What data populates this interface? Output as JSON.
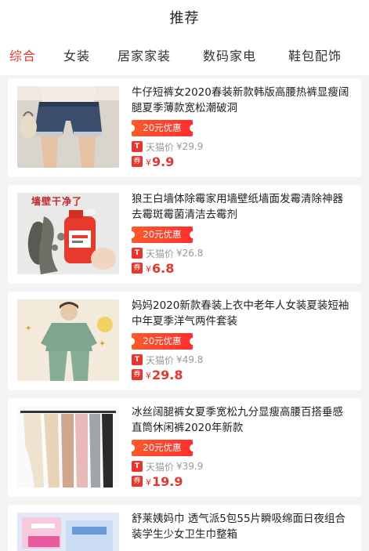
{
  "header": {
    "title": "推荐"
  },
  "tabs": [
    {
      "label": "综合",
      "active": true
    },
    {
      "label": "女装",
      "active": false
    },
    {
      "label": "居家家装",
      "active": false
    },
    {
      "label": "数码家电",
      "active": false
    },
    {
      "label": "鞋包配饰",
      "active": false
    }
  ],
  "products": [
    {
      "title": "牛仔短裤女2020春装新款韩版高腰热裤显瘦阔腿夏季薄款宽松潮破洞",
      "coupon": "20元优惠",
      "tmall_label": "天猫价",
      "tmall_price": "¥29.9",
      "currency": "¥",
      "final_price": "9.9",
      "image": "denim-shorts-photo"
    },
    {
      "title": "狼王白墙体除霉家用墙壁纸墙面发霉清除神器去霉斑霉菌清洁去霉剂",
      "coupon": "20元优惠",
      "tmall_label": "天猫价",
      "tmall_price": "¥26.8",
      "currency": "¥",
      "final_price": "6.8",
      "image": "mold-cleaner-photo",
      "image_text": "墙壁干净了"
    },
    {
      "title": "妈妈2020新款春装上衣中老年人女装夏装短袖中年夏季洋气两件套装",
      "coupon": "20元优惠",
      "tmall_label": "天猫价",
      "tmall_price": "¥49.8",
      "currency": "¥",
      "final_price": "29.8",
      "image": "mother-outfit-photo"
    },
    {
      "title": "冰丝阔腿裤女夏季宽松九分显瘦高腰百搭垂感直筒休闲裤2020年新款",
      "coupon": "20元优惠",
      "tmall_label": "天猫价",
      "tmall_price": "¥39.9",
      "currency": "¥",
      "final_price": "19.9",
      "image": "wide-leg-pants-photo"
    },
    {
      "title": "舒莱姨妈巾 透气派5包55片瞬吸绵面日夜组合装学生少女卫生巾整箱",
      "image": "sanitary-pad-photo"
    }
  ],
  "badges": {
    "tmall_icon": "T",
    "coupon_icon": "券"
  },
  "colors": {
    "accent": "#e8362c",
    "coupon_gradient_start": "#ff5a2a",
    "muted": "#999999",
    "background": "#f4f4f4"
  }
}
